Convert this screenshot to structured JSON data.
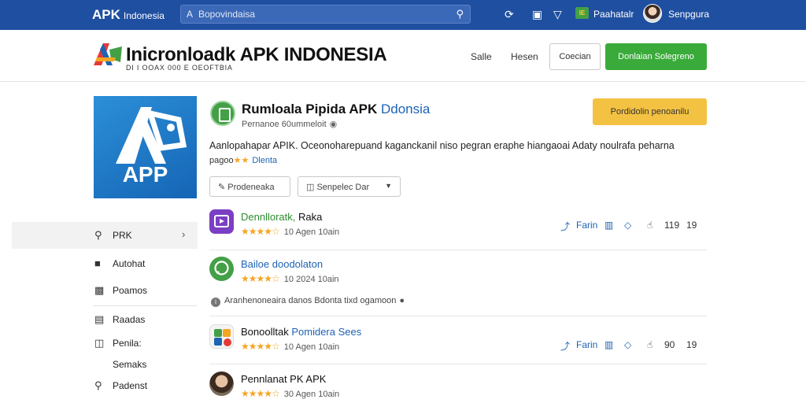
{
  "topbar": {
    "brand": "APK",
    "brand_sub": "Indonesia",
    "search_placeholder": "Bopovindaisa",
    "flag_text": "IE",
    "lang_label": "Paahatalr",
    "user_label": "Senpgura"
  },
  "header": {
    "title": "Inicronloadk APK INDONESIA",
    "tagline": "DI I OOAX 000 E OEOFTBIA",
    "nav": [
      "Salle",
      "Hesen"
    ],
    "outline_button": "Coecian",
    "green_button": "Donlaian Solegreno"
  },
  "app": {
    "icon_text": "APP",
    "title_main": "Rumloala Pipida APK",
    "title_blue": "Ddonsia",
    "subtitle": "Pernanoe 60ummeloit",
    "download_button": "Pordidolin penoanilu",
    "description": "Aanlopahapar APIK. Oceonoharepuand kaganckanil niso pegran eraphe hiangaoai Adaty noulrafa peharna",
    "rating_prefix": "pagoo",
    "rating_stars": "★★",
    "rating_link": "Dlenta",
    "button_share": "Prodeneaka",
    "button_sort": "Senpelec Dar"
  },
  "sidebar": {
    "items": [
      {
        "icon": "search-icon",
        "label": "PRK"
      },
      {
        "icon": "briefcase-icon",
        "label": "Autohat"
      },
      {
        "icon": "inbox-icon",
        "label": "Poamos"
      },
      {
        "icon": "list-icon",
        "label": "Raadas"
      },
      {
        "icon": "tag-icon",
        "label": "Penila:"
      },
      {
        "icon": "search-icon",
        "label": "Padenst"
      }
    ],
    "extra": "Semaks"
  },
  "list": {
    "rows": [
      {
        "name_a": "Dennlloratk,",
        "name_b": "Raka",
        "stars": "★★★★☆",
        "meta": "10 Agen 10ain",
        "action": "Farin",
        "count_a": "119",
        "count_b": "19"
      },
      {
        "name_a": "Bailoe doodolaton",
        "name_b": "",
        "stars": "★★★★☆",
        "meta": "10 2024 10ain"
      },
      {
        "name_a": "Bonoolltak",
        "name_b": "Pomidera Sees",
        "stars": "★★★★☆",
        "meta": "10 Agen 10ain",
        "action": "Farin",
        "count_a": "90",
        "count_b": "19"
      },
      {
        "name_a": "Pennlanat PK APK",
        "name_b": "",
        "stars": "★★★★☆",
        "meta": "30 Agen 10ain"
      }
    ],
    "notice": "Aranhenoneaira danos Bdonta tixd ogamoon"
  },
  "colors": {
    "topbar": "#1f4fa0",
    "accent_green": "#3aab3a",
    "accent_yellow": "#f4c242",
    "link": "#1e63b4"
  }
}
